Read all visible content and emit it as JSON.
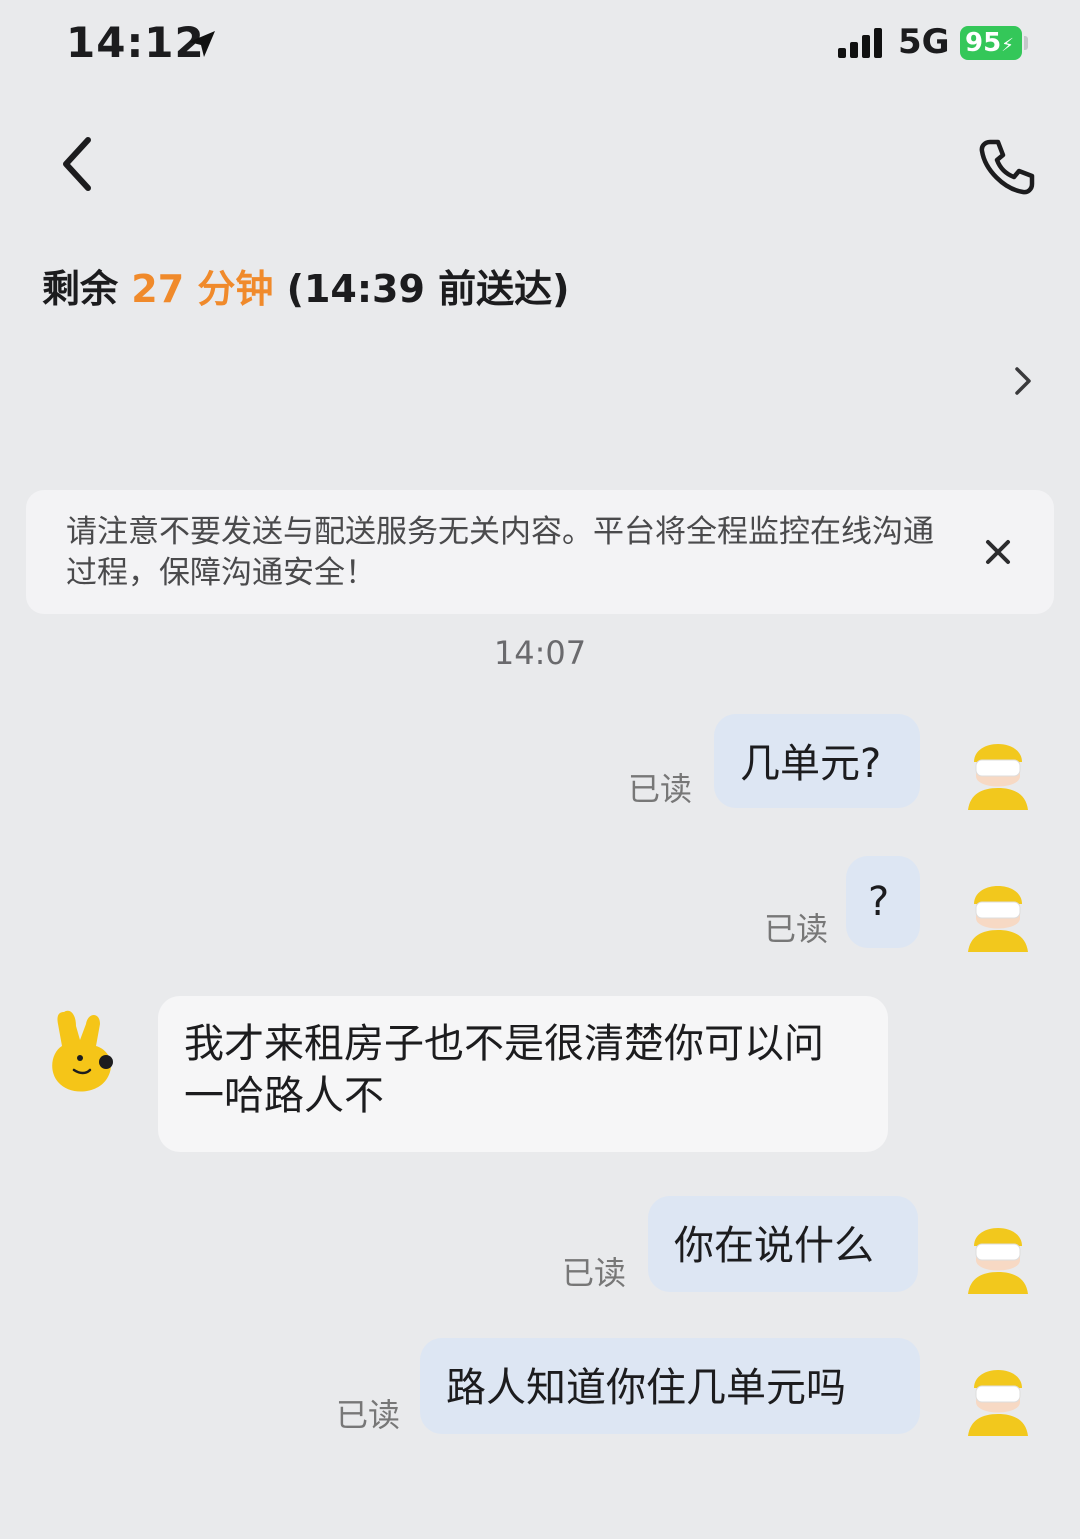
{
  "status_bar": {
    "time": "14:12",
    "network": "5G",
    "battery": "95"
  },
  "header": {
    "back_icon": "chevron-left-icon",
    "call_icon": "phone-icon"
  },
  "eta": {
    "prefix": "剩余",
    "minutes": "27 分钟",
    "suffix": "(14:39 前送达)",
    "accent_color": "#f08a2b"
  },
  "order_row": {
    "chevron_icon": "chevron-right-icon"
  },
  "notice": {
    "text": "请注意不要发送与配送服务无关内容。平台将全程监控在线沟通过程，保障沟通安全！",
    "close_icon": "close-icon"
  },
  "chat": {
    "timestamp": "14:07",
    "read_label": "已读",
    "messages": [
      {
        "side": "mine",
        "text": "几单元?"
      },
      {
        "side": "mine",
        "text": "?"
      },
      {
        "side": "theirs",
        "text": "我才来租房子也不是很清楚你可以问一哈路人不"
      },
      {
        "side": "mine",
        "text": "你在说什么"
      },
      {
        "side": "mine",
        "text": "路人知道你住几单元吗"
      }
    ]
  },
  "colors": {
    "background": "#e9eaec",
    "my_bubble": "#dde6f3",
    "their_bubble": "#f6f6f7",
    "battery_green": "#34c759"
  }
}
